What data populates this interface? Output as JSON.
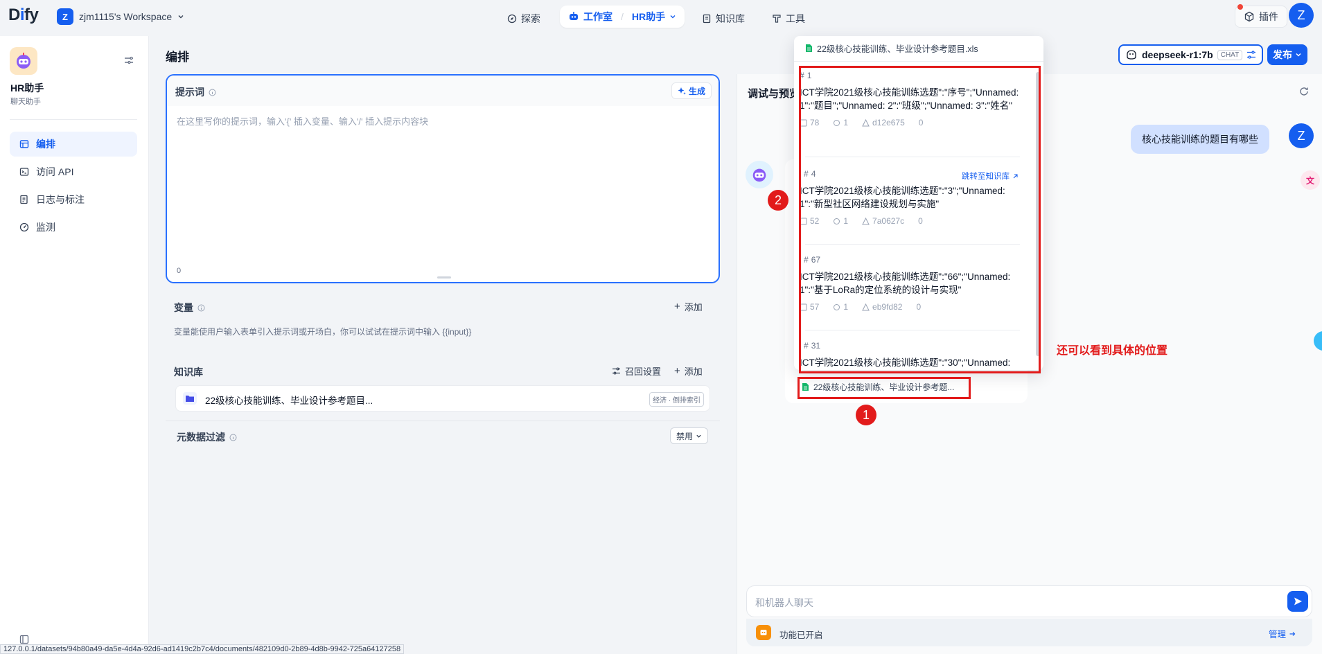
{
  "nav": {
    "logo": {
      "a": "D",
      "b": "i",
      "c": "fy"
    },
    "workspace_badge": "Z",
    "workspace_name": "zjm1115's Workspace",
    "explore": "探索",
    "studio": "工作室",
    "current_app": "HR助手",
    "knowledge": "知识库",
    "tools": "工具",
    "plugins": "插件",
    "user_avatar": "Z"
  },
  "sidebar": {
    "app_name": "HR助手",
    "app_type": "聊天助手",
    "items": [
      {
        "label": "编排",
        "icon": "layout-icon",
        "active": true
      },
      {
        "label": "访问 API",
        "icon": "terminal-icon",
        "active": false
      },
      {
        "label": "日志与标注",
        "icon": "file-list-icon",
        "active": false
      },
      {
        "label": "监测",
        "icon": "dashboard-icon",
        "active": false
      }
    ]
  },
  "orchestrate": {
    "title": "编排",
    "prompt": {
      "label": "提示词",
      "generate": "生成",
      "placeholder": "在这里写你的提示词，输入'{' 插入变量、输入'/' 插入提示内容块",
      "char_count": "0"
    },
    "variables": {
      "label": "变量",
      "add": "添加",
      "desc": "变量能使用户输入表单引入提示词或开场白，你可以试试在提示词中输入 {{input}}"
    },
    "knowledge": {
      "label": "知识库",
      "recall_settings": "召回设置",
      "add": "添加",
      "dataset_name": "22级核心技能训练、毕业设计参考题目...",
      "dataset_tag": "经济 · 倒排索引"
    },
    "metadata_filter": {
      "label": "元数据过滤",
      "value": "禁用"
    }
  },
  "debug": {
    "title": "调试与预览",
    "model_name": "deepseek-r1:7b",
    "model_mode": "CHAT",
    "publish": "发布",
    "user_message": "核心技能训练的题目有哪些",
    "user_avatar": "Z",
    "citation_file": "22级核心技能训练、毕业设计参考题...",
    "popup_file": "22级核心技能训练、毕业设计参考题目.xls",
    "jump_link": "跳转至知识库",
    "chunks": [
      {
        "id": "1",
        "text": "ICT学院2021级核心技能训练选题\":\"序号\";\"Unnamed: 1\":\"题目\";\"Unnamed: 2\":\"班级\";\"Unnamed: 3\":\"姓名\"",
        "words": "78",
        "hits": "1",
        "hash": "d12e675",
        "score": "0"
      },
      {
        "id": "4",
        "text": "ICT学院2021级核心技能训练选题\":\"3\";\"Unnamed: 1\":\"新型社区网络建设规划与实施\"",
        "words": "52",
        "hits": "1",
        "hash": "7a0627c",
        "score": "0"
      },
      {
        "id": "67",
        "text": "ICT学院2021级核心技能训练选题\":\"66\";\"Unnamed: 1\":\"基于LoRa的定位系统的设计与实现\"",
        "words": "57",
        "hits": "1",
        "hash": "eb9fd82",
        "score": "0"
      },
      {
        "id": "31",
        "text": "ICT学院2021级核心技能训练选题\":\"30\";\"Unnamed:",
        "words": "",
        "hits": "",
        "hash": "",
        "score": ""
      }
    ],
    "annotation_1": "1",
    "annotation_2": "2",
    "annotation_note": "还可以看到具体的位置",
    "chat_placeholder": "和机器人聊天",
    "features_enabled": "功能已开启",
    "manage": "管理"
  },
  "status_url": "127.0.0.1/datasets/94b80a49-da5e-4d4a-92d6-ad1419c2b7c4/documents/482109d0-2b89-4d8b-9942-725a64127258",
  "colors": {
    "accent": "#155eef",
    "annotation": "#e21b1b"
  }
}
